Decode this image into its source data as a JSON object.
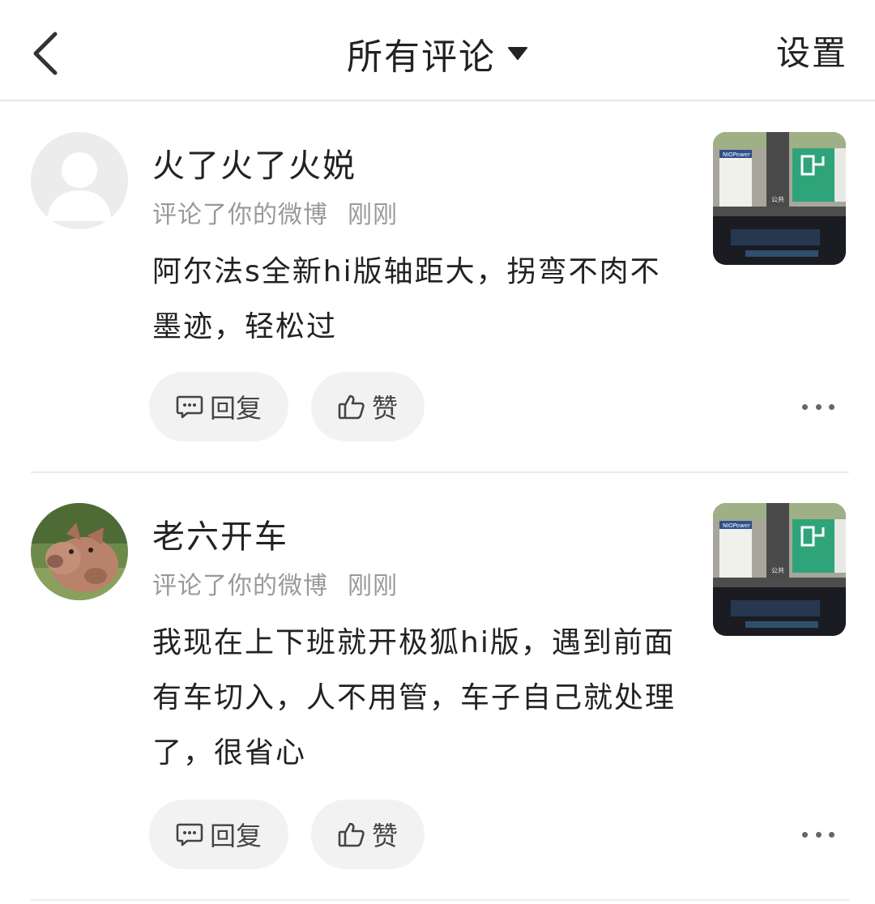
{
  "header": {
    "title": "所有评论",
    "settings_label": "设置"
  },
  "comments": [
    {
      "username": "火了火了火娧",
      "action": "评论了你的微博",
      "time": "刚刚",
      "text": "阿尔法s全新hi版轴距大，拐弯不肉不墨迹，轻松过",
      "reply_label": "回复",
      "like_label": "赞",
      "avatar": "default-avatar-icon",
      "thumbnail_text": {
        "brand": "NIOPower",
        "sign": "公共"
      }
    },
    {
      "username": "老六开车",
      "action": "评论了你的微博",
      "time": "刚刚",
      "text": "我现在上下班就开极狐hi版，遇到前面有车切入，人不用管，车子自己就处理了，很省心",
      "reply_label": "回复",
      "like_label": "赞",
      "avatar": "animal-photo-avatar",
      "thumbnail_text": {
        "brand": "NIOPower",
        "sign": "公共"
      }
    }
  ],
  "colors": {
    "accent_green": "#2fa37a",
    "meta_gray": "#999999",
    "pill_bg": "#f2f2f2"
  }
}
